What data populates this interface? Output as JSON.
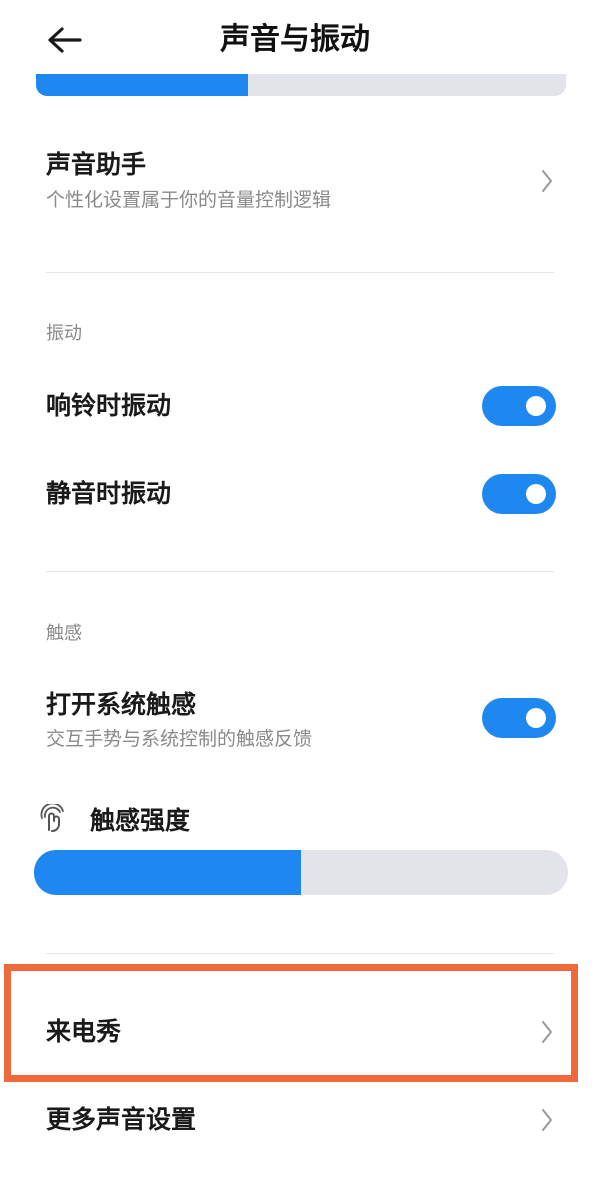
{
  "header": {
    "title": "声音与振动",
    "back_icon": "arrow-left-icon"
  },
  "top_volume_slider": {
    "level_percent": 40,
    "color": "#1e88f0"
  },
  "sound_assistant": {
    "title": "声音助手",
    "subtitle": "个性化设置属于你的音量控制逻辑"
  },
  "vibration": {
    "section_label": "振动",
    "items": [
      {
        "label": "响铃时振动",
        "enabled": true
      },
      {
        "label": "静音时振动",
        "enabled": true
      }
    ]
  },
  "haptics": {
    "section_label": "触感",
    "system_haptics": {
      "title": "打开系统触感",
      "subtitle": "交互手势与系统控制的触感反馈",
      "enabled": true
    },
    "intensity": {
      "label": "触感强度",
      "level_percent": 50
    }
  },
  "caller_show": {
    "label": "来电秀",
    "highlight_color": "#ef6a3b"
  },
  "more_sound": {
    "label": "更多声音设置"
  },
  "colors": {
    "accent": "#1e88f0",
    "track": "#e3e4e9"
  }
}
